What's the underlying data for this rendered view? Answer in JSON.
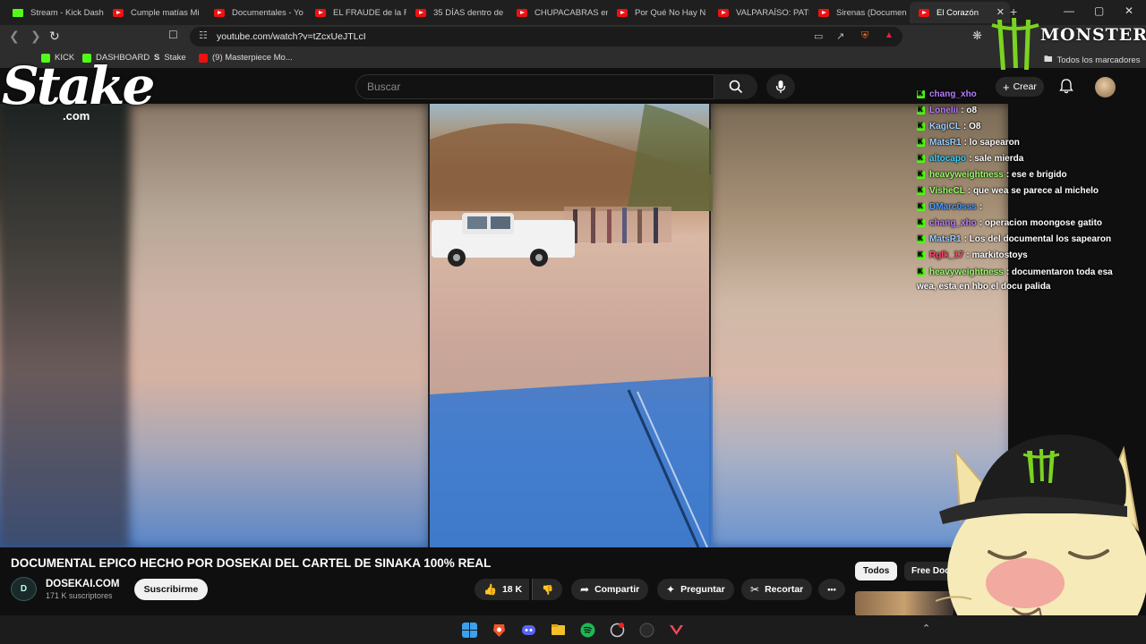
{
  "browser": {
    "tabs": [
      {
        "label": "Stream - Kick Dash",
        "icon": "kick"
      },
      {
        "label": "Cumple matías Mi",
        "icon": "youtube"
      },
      {
        "label": "Documentales - Yo",
        "icon": "youtube"
      },
      {
        "label": "EL FRAUDE de la FI",
        "icon": "youtube"
      },
      {
        "label": "35 DÍAS dentro de",
        "icon": "youtube"
      },
      {
        "label": "CHUPACABRAS en",
        "icon": "youtube"
      },
      {
        "label": "Por Qué No Hay N",
        "icon": "youtube"
      },
      {
        "label": "VALPARAÍSO: PATR",
        "icon": "youtube"
      },
      {
        "label": "Sirenas (Documen",
        "icon": "youtube"
      },
      {
        "label": "El Corazón",
        "icon": "youtube",
        "active": true
      }
    ],
    "new_tab": "+",
    "url": "youtube.com/watch?v=tZcxUeJTLcI",
    "bookmarks": [
      {
        "label": "KICK",
        "color": "#53fc18"
      },
      {
        "label": "DASHBOARD",
        "color": "#53fc18"
      },
      {
        "label": "Stake",
        "color": "#ffffff"
      },
      {
        "label": "(9) Masterpiece Mo...",
        "color": "#e11"
      }
    ],
    "all_bookmarks": "Todos los marcadores"
  },
  "youtube": {
    "search_placeholder": "Buscar",
    "create_label": "Crear",
    "video_title": "DOCUMENTAL EPICO HECHO POR DOSEKAI DEL CARTEL DE SINAKA 100% REAL",
    "channel": {
      "name": "DOSEKAI.COM",
      "subs": "171 K suscriptores",
      "avatar_text": "D"
    },
    "subscribe_label": "Suscribirme",
    "likes": "18 K",
    "share_label": "Compartir",
    "ask_label": "Preguntar",
    "clip_label": "Recortar",
    "more_label": "•••",
    "chips": {
      "all": "Todos",
      "free": "Free Doc"
    }
  },
  "chat": [
    {
      "user": "chang_xho",
      "msg": "",
      "user_color": "#b67dff"
    },
    {
      "user": "Lonelii",
      "msg": ": o8",
      "user_color": "#b67dff"
    },
    {
      "user": "KagiCL",
      "msg": ": O8",
      "user_color": "#9ed0ff"
    },
    {
      "user": "MatsR1",
      "msg": ": lo sapearon",
      "user_color": "#9ed0ff"
    },
    {
      "user": "altocapo",
      "msg": ": sale mierda",
      "user_color": "#3bd1ff"
    },
    {
      "user": "heavyweightness",
      "msg": ": ese e brigido",
      "user_color": "#9dff6a"
    },
    {
      "user": "VisheCL",
      "msg": ": que wea se parece al michelo",
      "user_color": "#9dff6a"
    },
    {
      "user": "DMarc0sss",
      "msg": ":",
      "user_color": "#4a9cff"
    },
    {
      "user": "chang_xho",
      "msg": ": operacion moongose gatito",
      "user_color": "#b67dff"
    },
    {
      "user": "MatsR1",
      "msg": ": Los del documental los sapearon",
      "user_color": "#9ed0ff"
    },
    {
      "user": "Rglk_17",
      "msg": ": markitostoys",
      "user_color": "#ff4a6a"
    },
    {
      "user": "heavyweightness",
      "msg": ": documentaron toda esa",
      "user_color": "#9dff6a"
    },
    {
      "user": "",
      "msg": "wea, esta en hbo el docu palida",
      "user_color": "#ffffff"
    }
  ],
  "overlays": {
    "stake_brand": "Stake",
    "stake_domain": ".com",
    "monster_brand": "MONSTER"
  }
}
